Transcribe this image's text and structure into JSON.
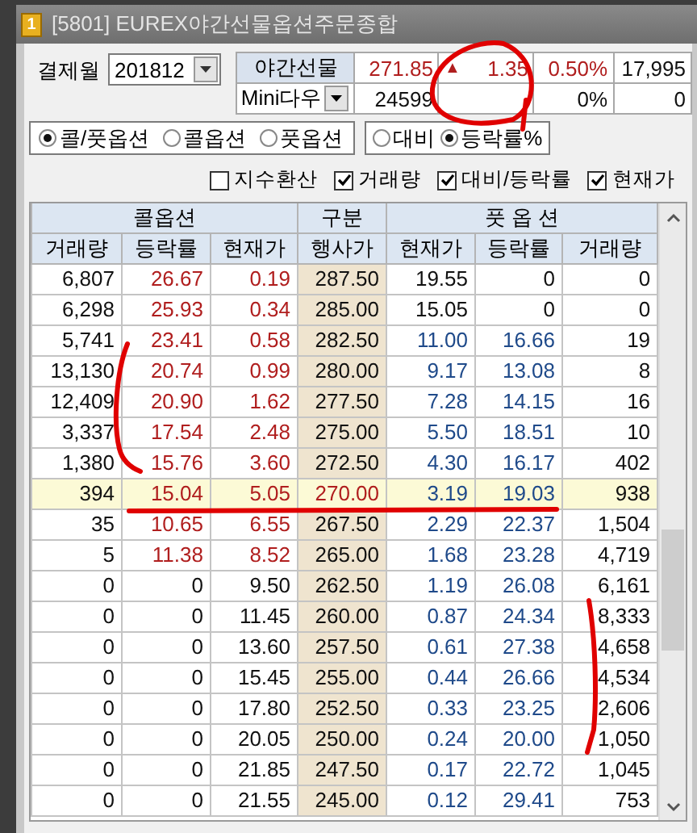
{
  "window": {
    "badge": "1",
    "title": "[5801] EUREX야간선물옵션주문종합"
  },
  "settlement": {
    "label": "결제월",
    "value": "201812"
  },
  "futures": [
    {
      "kind": "label",
      "name": "야간선물",
      "price": "271.85",
      "arrow": "▲",
      "change": "1.35",
      "rate": "0.50%",
      "volume": "17,995",
      "color": "#b01e1e"
    },
    {
      "kind": "dropdown",
      "name": "Mini다우",
      "price": "24599",
      "rate": "0%",
      "volume": "0",
      "color": "#111111"
    }
  ],
  "view_options": [
    {
      "label": "콜/풋옵션",
      "selected": true
    },
    {
      "label": "콜옵션",
      "selected": false
    },
    {
      "label": "풋옵션",
      "selected": false
    }
  ],
  "display_options": [
    {
      "label": "대비",
      "selected": false
    },
    {
      "label": "등락률%",
      "selected": true
    }
  ],
  "checkboxes": [
    {
      "label": "지수환산",
      "checked": false
    },
    {
      "label": "거래량",
      "checked": true
    },
    {
      "label": "대비/등락률",
      "checked": true
    },
    {
      "label": "현재가",
      "checked": true
    }
  ],
  "table": {
    "groups": [
      "콜옵션",
      "구분",
      "풋 옵 션"
    ],
    "columns": [
      "거래량",
      "등락률",
      "현재가",
      "행사가",
      "현재가",
      "등락률",
      "거래량"
    ],
    "rows": [
      {
        "call": {
          "volume": "6,807",
          "change": "26.67",
          "price": "0.19",
          "color": "#b01e1e"
        },
        "strike": "287.50",
        "put": {
          "price": "19.55",
          "change": "0",
          "volume": "0",
          "color": "#111111"
        },
        "atm": false
      },
      {
        "call": {
          "volume": "6,298",
          "change": "25.93",
          "price": "0.34",
          "color": "#b01e1e"
        },
        "strike": "285.00",
        "put": {
          "price": "15.05",
          "change": "0",
          "volume": "0",
          "color": "#111111"
        },
        "atm": false
      },
      {
        "call": {
          "volume": "5,741",
          "change": "23.41",
          "price": "0.58",
          "color": "#b01e1e"
        },
        "strike": "282.50",
        "put": {
          "price": "11.00",
          "change": "16.66",
          "volume": "19",
          "color": "#1f4a8a"
        },
        "atm": false
      },
      {
        "call": {
          "volume": "13,130",
          "change": "20.74",
          "price": "0.99",
          "color": "#b01e1e"
        },
        "strike": "280.00",
        "put": {
          "price": "9.17",
          "change": "13.08",
          "volume": "8",
          "color": "#1f4a8a"
        },
        "atm": false
      },
      {
        "call": {
          "volume": "12,409",
          "change": "20.90",
          "price": "1.62",
          "color": "#b01e1e"
        },
        "strike": "277.50",
        "put": {
          "price": "7.28",
          "change": "14.15",
          "volume": "16",
          "color": "#1f4a8a"
        },
        "atm": false
      },
      {
        "call": {
          "volume": "3,337",
          "change": "17.54",
          "price": "2.48",
          "color": "#b01e1e"
        },
        "strike": "275.00",
        "put": {
          "price": "5.50",
          "change": "18.51",
          "volume": "10",
          "color": "#1f4a8a"
        },
        "atm": false
      },
      {
        "call": {
          "volume": "1,380",
          "change": "15.76",
          "price": "3.60",
          "color": "#b01e1e"
        },
        "strike": "272.50",
        "put": {
          "price": "4.30",
          "change": "16.17",
          "volume": "402",
          "color": "#1f4a8a"
        },
        "atm": false
      },
      {
        "call": {
          "volume": "394",
          "change": "15.04",
          "price": "5.05",
          "color": "#b01e1e"
        },
        "strike": "270.00",
        "put": {
          "price": "3.19",
          "change": "19.03",
          "volume": "938",
          "color": "#1f4a8a"
        },
        "atm": true
      },
      {
        "call": {
          "volume": "35",
          "change": "10.65",
          "price": "6.55",
          "color": "#b01e1e"
        },
        "strike": "267.50",
        "put": {
          "price": "2.29",
          "change": "22.37",
          "volume": "1,504",
          "color": "#1f4a8a"
        },
        "atm": false
      },
      {
        "call": {
          "volume": "5",
          "change": "11.38",
          "price": "8.52",
          "color": "#b01e1e"
        },
        "strike": "265.00",
        "put": {
          "price": "1.68",
          "change": "23.28",
          "volume": "4,719",
          "color": "#1f4a8a"
        },
        "atm": false
      },
      {
        "call": {
          "volume": "0",
          "change": "0",
          "price": "9.50",
          "color": "#111111"
        },
        "strike": "262.50",
        "put": {
          "price": "1.19",
          "change": "26.08",
          "volume": "6,161",
          "color": "#1f4a8a"
        },
        "atm": false
      },
      {
        "call": {
          "volume": "0",
          "change": "0",
          "price": "11.45",
          "color": "#111111"
        },
        "strike": "260.00",
        "put": {
          "price": "0.87",
          "change": "24.34",
          "volume": "8,333",
          "color": "#1f4a8a"
        },
        "atm": false
      },
      {
        "call": {
          "volume": "0",
          "change": "0",
          "price": "13.60",
          "color": "#111111"
        },
        "strike": "257.50",
        "put": {
          "price": "0.61",
          "change": "27.38",
          "volume": "4,658",
          "color": "#1f4a8a"
        },
        "atm": false
      },
      {
        "call": {
          "volume": "0",
          "change": "0",
          "price": "15.45",
          "color": "#111111"
        },
        "strike": "255.00",
        "put": {
          "price": "0.44",
          "change": "26.66",
          "volume": "4,534",
          "color": "#1f4a8a"
        },
        "atm": false
      },
      {
        "call": {
          "volume": "0",
          "change": "0",
          "price": "17.80",
          "color": "#111111"
        },
        "strike": "252.50",
        "put": {
          "price": "0.33",
          "change": "23.25",
          "volume": "2,606",
          "color": "#1f4a8a"
        },
        "atm": false
      },
      {
        "call": {
          "volume": "0",
          "change": "0",
          "price": "20.05",
          "color": "#111111"
        },
        "strike": "250.00",
        "put": {
          "price": "0.24",
          "change": "20.00",
          "volume": "1,050",
          "color": "#1f4a8a"
        },
        "atm": false
      },
      {
        "call": {
          "volume": "0",
          "change": "0",
          "price": "21.85",
          "color": "#111111"
        },
        "strike": "247.50",
        "put": {
          "price": "0.17",
          "change": "22.72",
          "volume": "1,045",
          "color": "#1f4a8a"
        },
        "atm": false
      },
      {
        "call": {
          "volume": "0",
          "change": "0",
          "price": "21.55",
          "color": "#111111"
        },
        "strike": "245.00",
        "put": {
          "price": "0.12",
          "change": "29.41",
          "volume": "753",
          "color": "#1f4a8a"
        },
        "atm": false
      }
    ]
  }
}
